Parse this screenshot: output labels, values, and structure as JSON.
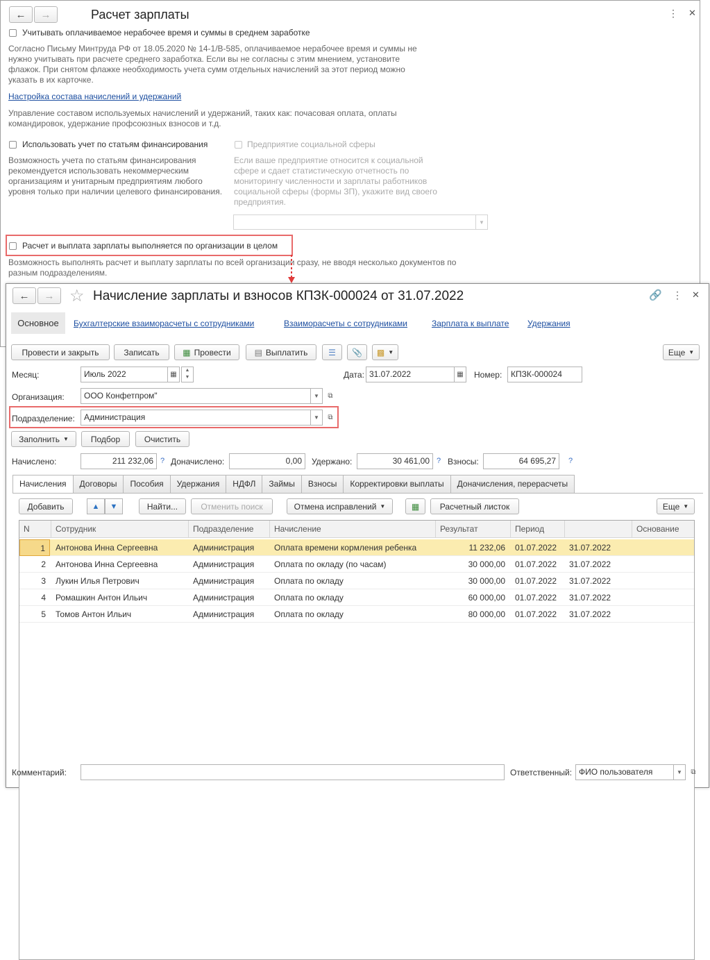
{
  "settings": {
    "title": "Расчет зарплаты",
    "paid_nonwork_label": "Учитывать оплачиваемое нерабочее время и суммы в среднем заработке",
    "paid_nonwork_note": "Согласно Письму Минтруда РФ от 18.05.2020 № 14-1/В-585, оплачиваемое нерабочее время и суммы не нужно учитывать при расчете среднего заработка. Если вы не согласны с этим мнением, установите флажок. При снятом флажке необходимость учета сумм отдельных начислений за этот период можно указать в их карточке.",
    "accruals_link": "Настройка состава начислений и удержаний",
    "accruals_note": "Управление составом используемых начислений и удержаний, таких как: почасовая оплата, оплаты командировок, удержание профсоюзных взносов и т.д.",
    "financing_label": "Использовать учет по статьям финансирования",
    "financing_note": "Возможность учета по статьям финансирования рекомендуется использовать некоммерческим организациям и унитарным предприятиям любого уровня только при наличии целевого финансирования.",
    "social_label": "Предприятие социальной сферы",
    "social_note": "Если ваше предприятие относится к социальной сфере и сдает статистическую отчетность по мониторингу численности и зарплаты работников социальной сферы (формы ЗП), укажите вид своего предприятия.",
    "whole_org_label": "Расчет и выплата зарплаты выполняется по организации в целом",
    "whole_org_note": "Возможность выполнять расчет и выплату зарплаты по всей организации сразу, не вводя несколько документов по разным подразделениям."
  },
  "doc": {
    "title": "Начисление зарплаты и взносов КПЗК-000024 от 31.07.2022",
    "links": [
      "Основное",
      "Бухгалтерские взаиморасчеты с сотрудниками",
      "Взаиморасчеты с сотрудниками",
      "Зарплата к выплате",
      "Удержания"
    ],
    "toolbar": {
      "post_close": "Провести и закрыть",
      "save": "Записать",
      "post": "Провести",
      "pay": "Выплатить",
      "more": "Еще"
    },
    "month_label": "Месяц:",
    "month_value": "Июль 2022",
    "date_label": "Дата:",
    "date_value": "31.07.2022",
    "number_label": "Номер:",
    "number_value": "КПЗК-000024",
    "org_label": "Организация:",
    "org_value": "ООО Конфетпром\"",
    "dept_label": "Подразделение:",
    "dept_value": "Администрация",
    "fill": "Заполнить",
    "pick": "Подбор",
    "clear": "Очистить",
    "accrued_label": "Начислено:",
    "accrued_value": "211 232,06",
    "extra_label": "Доначислено:",
    "extra_value": "0,00",
    "withheld_label": "Удержано:",
    "withheld_value": "30 461,00",
    "contrib_label": "Взносы:",
    "contrib_value": "64 695,27",
    "q": "?",
    "tabs": [
      "Начисления",
      "Договоры",
      "Пособия",
      "Удержания",
      "НДФЛ",
      "Займы",
      "Взносы",
      "Корректировки выплаты",
      "Доначисления, перерасчеты"
    ],
    "table_toolbar": {
      "add": "Добавить",
      "find": "Найти...",
      "cancel_search": "Отменить поиск",
      "cancel_fix": "Отмена исправлений",
      "payslip": "Расчетный листок",
      "more": "Еще"
    },
    "columns": [
      "N",
      "Сотрудник",
      "Подразделение",
      "Начисление",
      "Результат",
      "Период",
      "",
      "Основание"
    ],
    "rows": [
      [
        "1",
        "Антонова Инна Сергеевна",
        "Администрация",
        "Оплата времени кормления ребенка",
        "11 232,06",
        "01.07.2022",
        "31.07.2022",
        ""
      ],
      [
        "2",
        "Антонова Инна Сергеевна",
        "Администрация",
        "Оплата по окладу (по часам)",
        "30 000,00",
        "01.07.2022",
        "31.07.2022",
        ""
      ],
      [
        "3",
        "Лукин Илья Петрович",
        "Администрация",
        "Оплата по окладу",
        "30 000,00",
        "01.07.2022",
        "31.07.2022",
        ""
      ],
      [
        "4",
        "Ромашкин Антон Ильич",
        "Администрация",
        "Оплата по окладу",
        "60 000,00",
        "01.07.2022",
        "31.07.2022",
        ""
      ],
      [
        "5",
        "Томов Антон Ильич",
        "Администрация",
        "Оплата по окладу",
        "80 000,00",
        "01.07.2022",
        "31.07.2022",
        ""
      ]
    ],
    "comment_label": "Комментарий:",
    "responsible_label": "Ответственный:",
    "responsible_value": "ФИО пользователя"
  },
  "colors": {
    "highlight": "#e86a6a",
    "link": "#1c4ea0",
    "selected_row": "#fbecb0"
  }
}
